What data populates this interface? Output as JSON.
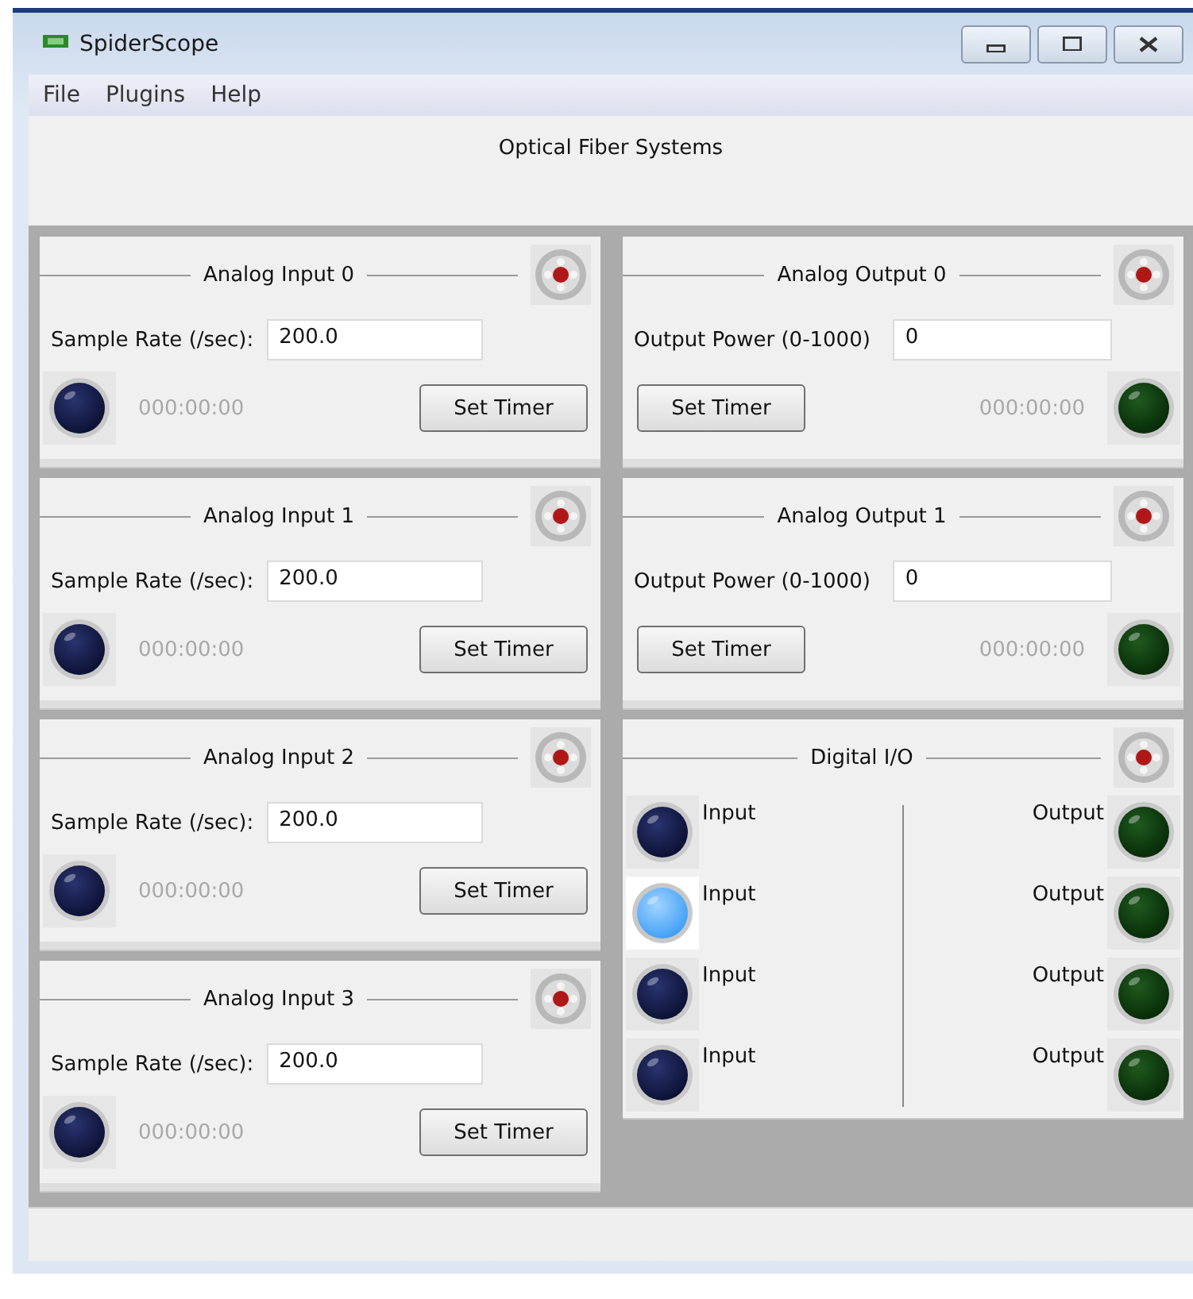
{
  "window": {
    "title": "SpiderScope"
  },
  "menu": [
    {
      "label": "File"
    },
    {
      "label": "Plugins"
    },
    {
      "label": "Help"
    }
  ],
  "header": "Optical Fiber Systems",
  "columns": [
    {
      "panels": [
        {
          "kind": "input",
          "title": "Analog Input 0",
          "field_label": "Sample Rate (/sec):",
          "value": "200.0",
          "timer": "000:00:00",
          "button": "Set Timer",
          "lit": false
        },
        {
          "kind": "input",
          "title": "Analog Input 1",
          "field_label": "Sample Rate (/sec):",
          "value": "200.0",
          "timer": "000:00:00",
          "button": "Set Timer",
          "lit": false
        },
        {
          "kind": "input",
          "title": "Analog Input 2",
          "field_label": "Sample Rate (/sec):",
          "value": "200.0",
          "timer": "000:00:00",
          "button": "Set Timer",
          "lit": false
        },
        {
          "kind": "input",
          "title": "Analog Input 3",
          "field_label": "Sample Rate (/sec):",
          "value": "200.0",
          "timer": "000:00:00",
          "button": "Set Timer",
          "lit": false
        }
      ]
    },
    {
      "panels": [
        {
          "kind": "output",
          "title": "Analog Output 0",
          "field_label": "Output Power (0-1000)",
          "value": "0",
          "timer": "000:00:00",
          "button": "Set Timer",
          "lit": false
        },
        {
          "kind": "output",
          "title": "Analog Output 1",
          "field_label": "Output Power (0-1000)",
          "value": "0",
          "timer": "000:00:00",
          "button": "Set Timer",
          "lit": false
        },
        {
          "kind": "digital",
          "title": "Digital I/O",
          "inputs": [
            {
              "label": "Input",
              "lit": false
            },
            {
              "label": "Input",
              "lit": true
            },
            {
              "label": "Input",
              "lit": false
            },
            {
              "label": "Input",
              "lit": false
            }
          ],
          "outputs": [
            {
              "label": "Output",
              "lit": false
            },
            {
              "label": "Output",
              "lit": false
            },
            {
              "label": "Output",
              "lit": false
            },
            {
              "label": "Output",
              "lit": false
            }
          ]
        }
      ]
    }
  ]
}
